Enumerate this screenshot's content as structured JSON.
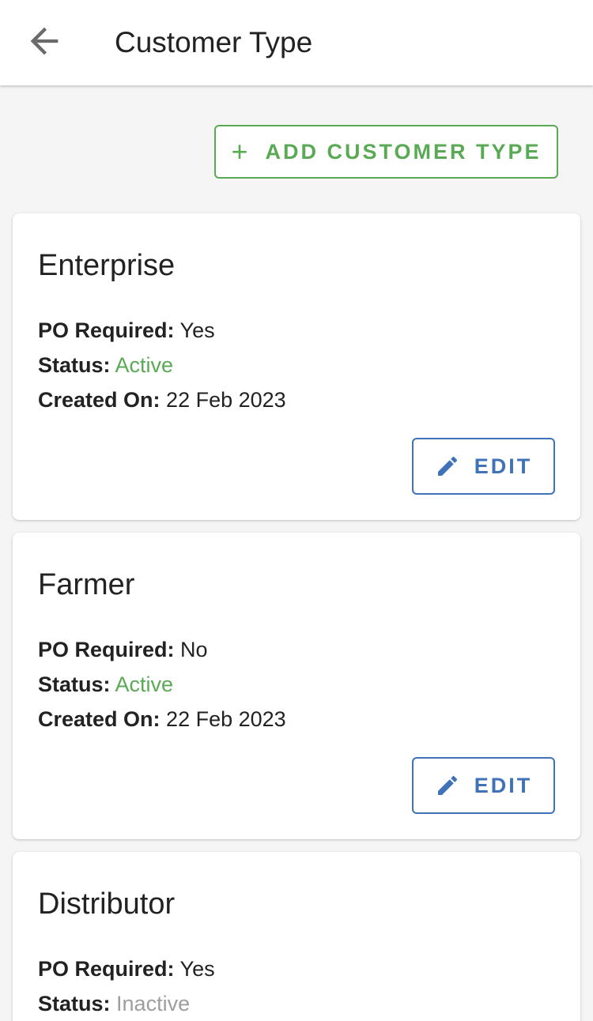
{
  "header": {
    "title": "Customer Type",
    "back_icon": "arrow-left-icon"
  },
  "toolbar": {
    "add_label": "ADD CUSTOMER TYPE",
    "add_icon": "plus-icon",
    "add_icon_glyph": "+"
  },
  "labels": {
    "po_required": "PO Required:",
    "status": "Status:",
    "created_on": "Created On:",
    "edit": "EDIT"
  },
  "colors": {
    "active": "#5aaa55",
    "inactive": "#9e9e9e",
    "edit_accent": "#3f72b8",
    "add_accent": "#5aaa55"
  },
  "customer_types": [
    {
      "name": "Enterprise",
      "po_required": "Yes",
      "status": "Active",
      "created_on": "22 Feb 2023"
    },
    {
      "name": "Farmer",
      "po_required": "No",
      "status": "Active",
      "created_on": "22 Feb 2023"
    },
    {
      "name": "Distributor",
      "po_required": "Yes",
      "status": "Inactive"
    }
  ]
}
